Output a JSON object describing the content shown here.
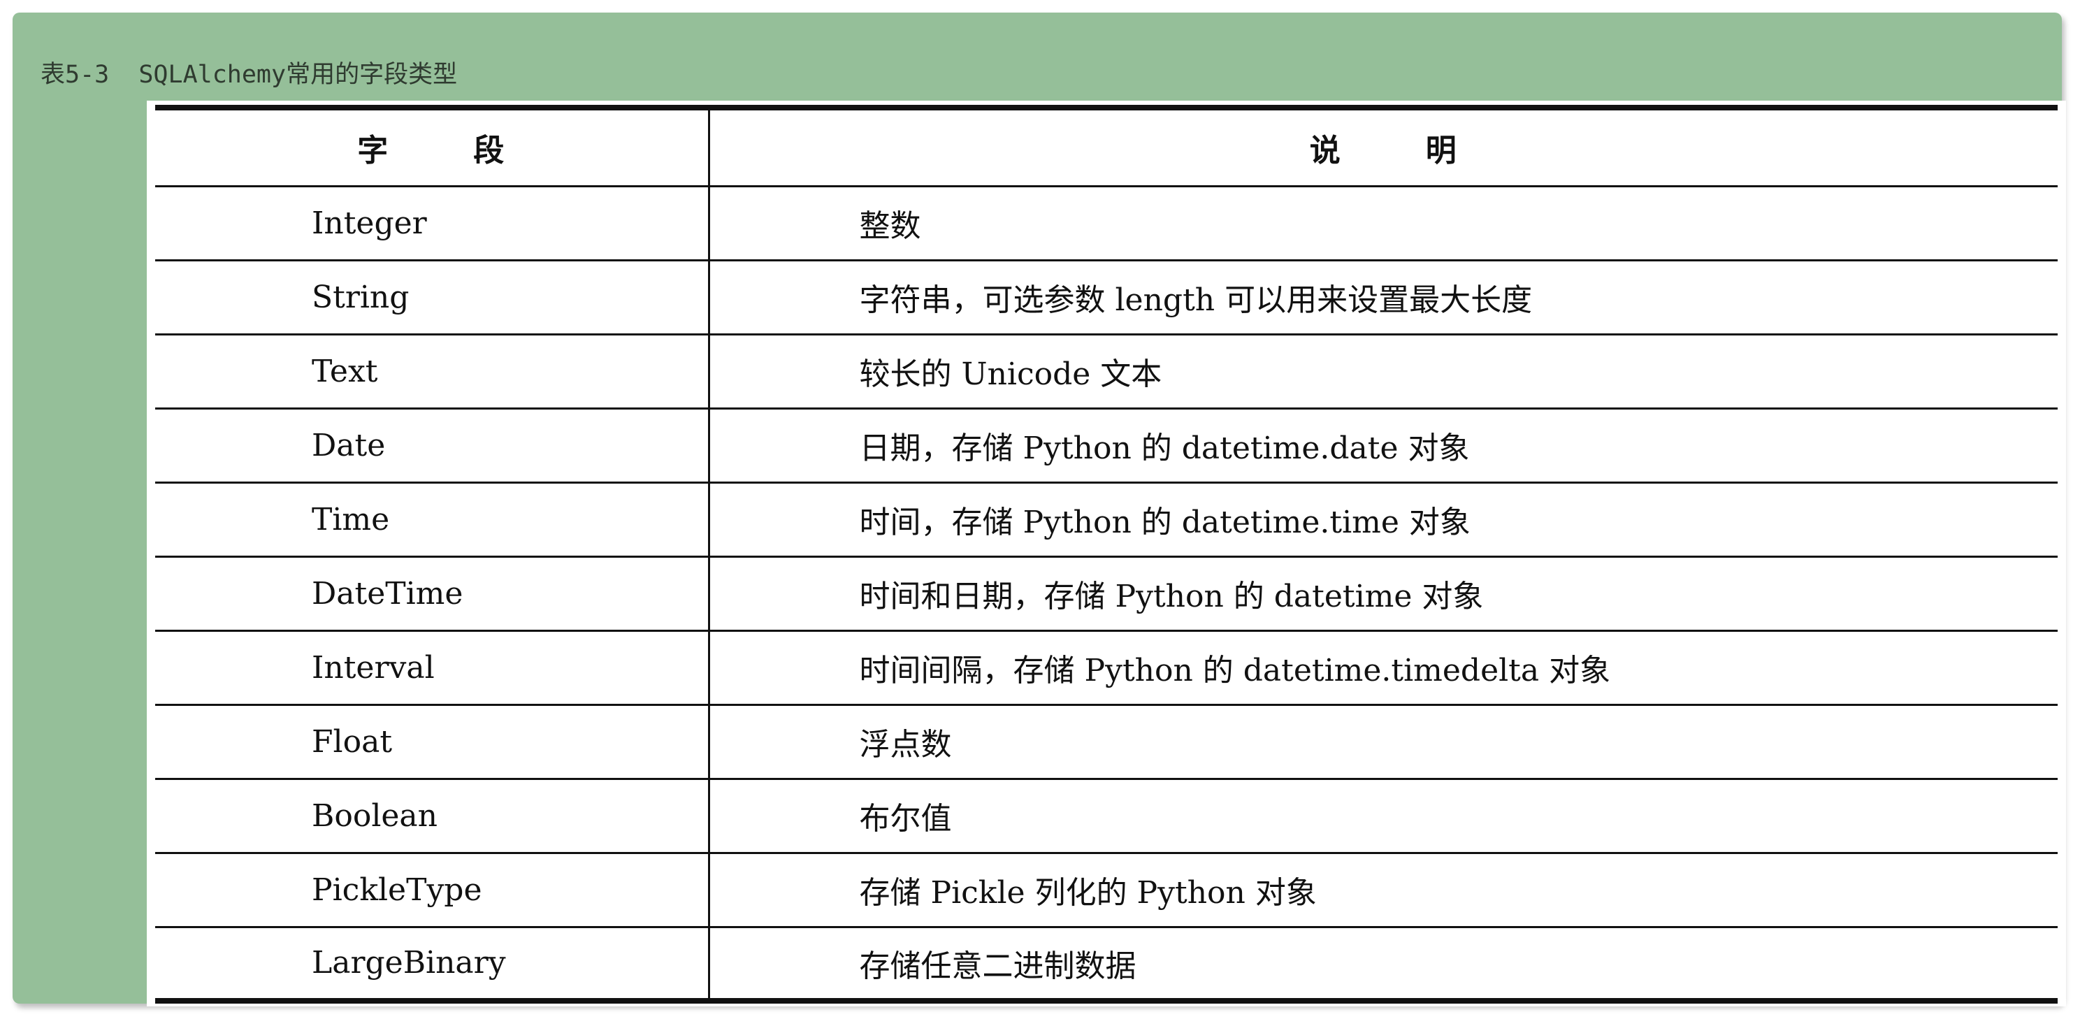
{
  "caption": "表5-3  SQLAlchemy常用的字段类型",
  "table": {
    "headers": {
      "field": [
        "字",
        "段"
      ],
      "desc": [
        "说",
        "明"
      ]
    },
    "rows": [
      {
        "field": "Integer",
        "desc": "整数"
      },
      {
        "field": "String",
        "desc": "字符串，可选参数 length 可以用来设置最大长度"
      },
      {
        "field": "Text",
        "desc": "较长的 Unicode 文本"
      },
      {
        "field": "Date",
        "desc": "日期，存储 Python 的 datetime.date 对象"
      },
      {
        "field": "Time",
        "desc": "时间，存储 Python 的 datetime.time 对象"
      },
      {
        "field": "DateTime",
        "desc": "时间和日期，存储 Python 的 datetime 对象"
      },
      {
        "field": "Interval",
        "desc": "时间间隔，存储 Python 的 datetime.timedelta 对象"
      },
      {
        "field": "Float",
        "desc": "浮点数"
      },
      {
        "field": "Boolean",
        "desc": "布尔值"
      },
      {
        "field": "PickleType",
        "desc": "存储 Pickle 列化的 Python 对象"
      },
      {
        "field": "LargeBinary",
        "desc": "存储任意二进制数据"
      }
    ]
  },
  "colors": {
    "frame": "#95bf99",
    "rule": "#111111"
  }
}
